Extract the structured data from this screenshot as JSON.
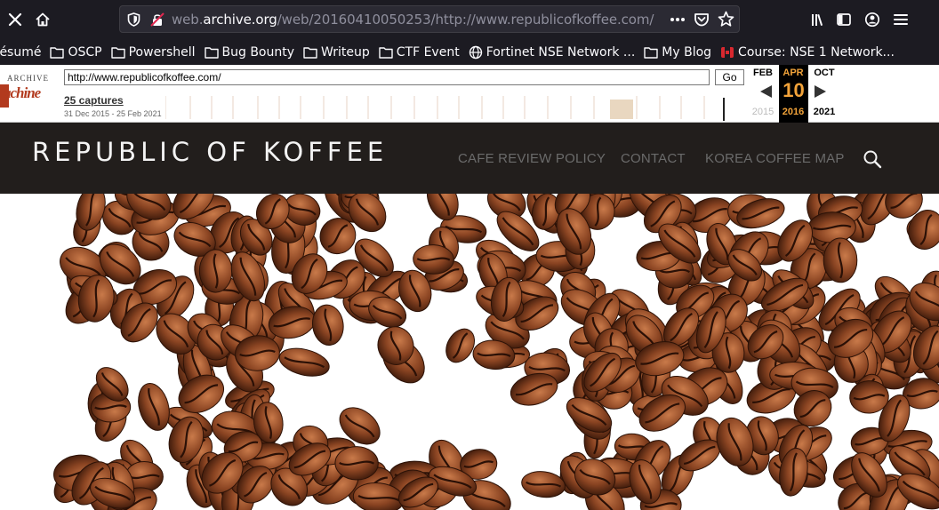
{
  "browser": {
    "url_prefix": "web.",
    "url_host": "archive.org",
    "url_path": "/web/20160410050253/http://www.republicofkoffee.com/",
    "icons": {
      "close": "close-icon",
      "home": "home-icon",
      "shield": "tracking-shield-icon",
      "insecure": "insecure-lock-icon",
      "more": "more-dots-icon",
      "pocket": "pocket-icon",
      "bookmark": "star-icon",
      "library": "library-icon",
      "sidebar": "sidebar-icon",
      "account": "account-icon",
      "menu": "hamburger-menu-icon"
    }
  },
  "bookmarks": [
    {
      "label": "résumé",
      "icon": "none"
    },
    {
      "label": "OSCP",
      "icon": "folder-icon"
    },
    {
      "label": "Powershell",
      "icon": "folder-icon"
    },
    {
      "label": "Bug Bounty",
      "icon": "folder-icon"
    },
    {
      "label": "Writeup",
      "icon": "folder-icon"
    },
    {
      "label": "CTF Event",
      "icon": "folder-icon"
    },
    {
      "label": "Fortinet NSE Network ...",
      "icon": "globe-icon"
    },
    {
      "label": "My Blog",
      "icon": "folder-icon"
    },
    {
      "label": "Course: NSE 1 Network...",
      "icon": "fortinet-icon"
    }
  ],
  "wayback": {
    "logo_top": "ARCHIVE",
    "logo_main": "achine",
    "url_value": "http://www.republicofkoffee.com/",
    "go_label": "Go",
    "captures": "25 captures",
    "range": "31 Dec 2015 - 25 Feb 2021",
    "prev_month": "FEB",
    "cur_month": "APR",
    "next_month": "OCT",
    "day": "10",
    "prev_year": "2015",
    "cur_year": "2016",
    "next_year": "2021",
    "highlight": "#f2a33a"
  },
  "site": {
    "title": "REPUBLIC OF KOFFEE",
    "nav": [
      "CAFE REVIEW POLICY",
      "CONTACT",
      "KOREA COFFEE MAP"
    ],
    "search_icon": "search-icon",
    "header_bg": "#221e1c"
  }
}
